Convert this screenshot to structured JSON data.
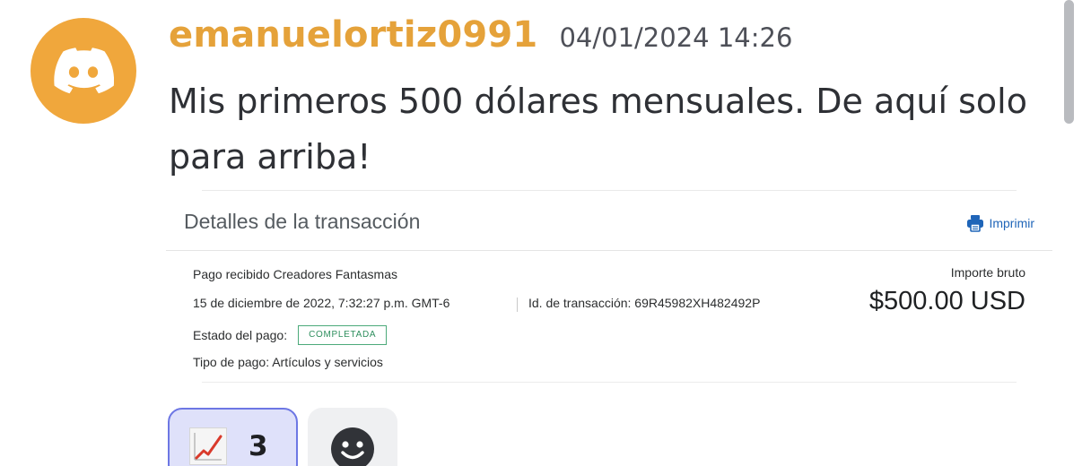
{
  "author": {
    "username": "emanuelortiz0991",
    "timestamp": "04/01/2024 14:26",
    "avatar_icon": "discord-logo-icon",
    "color": "#e5a23a"
  },
  "message": {
    "text": "Mis primeros 500 dólares mensuales. De aquí solo para arriba!"
  },
  "embed": {
    "title": "Detalles de la transacción",
    "print_label": "Imprimir",
    "print_icon": "printer-icon",
    "description": "Pago recibido Creadores Fantasmas",
    "date": "15 de diciembre de 2022, 7:32:27 p.m. GMT-6",
    "transaction_id": "Id. de transacción: 69R45982XH482492P",
    "status_label": "Estado del pago:",
    "status_value": "COMPLETADA",
    "status_color": "#4caa7a",
    "payment_type": "Tipo de pago: Artículos y servicios",
    "amount_label": "Importe bruto",
    "amount": "$500.00 USD",
    "link_color": "#1f65b8"
  },
  "reactions": [
    {
      "emoji": "chart-increasing-icon",
      "count": "3",
      "selected": true
    }
  ],
  "add_reaction_icon": "smiley-face-icon"
}
